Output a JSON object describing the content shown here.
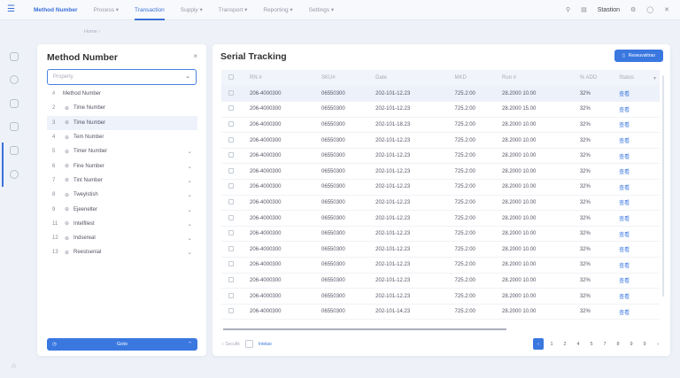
{
  "topbar": {
    "tabs": [
      {
        "label": "Method Number"
      },
      {
        "label": "Process ▾"
      },
      {
        "label": "Transaction"
      },
      {
        "label": "Supply ▾"
      },
      {
        "label": "Transport ▾"
      },
      {
        "label": "Reporting ▾"
      },
      {
        "label": "Settings ▾"
      }
    ],
    "user": "Stastion"
  },
  "breadcrumb": "Home ›",
  "left": {
    "title": "Method Number",
    "select_placeholder": "Property",
    "items": [
      {
        "n": "#",
        "label": "Method Number"
      },
      {
        "n": "2",
        "label": "Time Number"
      },
      {
        "n": "3",
        "label": "Time Number"
      },
      {
        "n": "4",
        "label": "Tem Number"
      },
      {
        "n": "5",
        "label": "Timer Number"
      },
      {
        "n": "6",
        "label": "Fine Number"
      },
      {
        "n": "7",
        "label": "Tint Number"
      },
      {
        "n": "8",
        "label": "Tweylstish"
      },
      {
        "n": "9",
        "label": "Ejeenelter"
      },
      {
        "n": "11",
        "label": "Intelfilest"
      },
      {
        "n": "12",
        "label": "Indsereal"
      },
      {
        "n": "13",
        "label": "Reestsenial"
      }
    ],
    "go_label": "Goto"
  },
  "main": {
    "title": "Serial Tracking",
    "export_label": "Reseuvsiitrao",
    "columns": [
      "RN #",
      "SKU#",
      "Date",
      "MKD",
      "Run #",
      "% ADD",
      "Status"
    ],
    "rows": [
      [
        "206-4000300",
        "06550300",
        "202-101-12.23",
        "725.2:00",
        "28.2000 10.00",
        "32%",
        "查看"
      ],
      [
        "206-4000300",
        "06550300",
        "202-101-12.23",
        "725.2:00",
        "28.2000 15.00",
        "32%",
        "查看"
      ],
      [
        "206-4000300",
        "06550300",
        "202-101-18.23",
        "725.2:00",
        "28.2000 10.00",
        "32%",
        "查看"
      ],
      [
        "206-4000300",
        "06550300",
        "202-101-12.23",
        "725.2:00",
        "28.2000 10.00",
        "32%",
        "查看"
      ],
      [
        "206-4000300",
        "06550300",
        "202-101-12.23",
        "725.2:00",
        "28.2000 10.00",
        "32%",
        "查看"
      ],
      [
        "206-4000300",
        "06550300",
        "202-101-12.23",
        "725.2:00",
        "28.2000 10.00",
        "32%",
        "查看"
      ],
      [
        "206-4000300",
        "06550300",
        "202-101-12.23",
        "725.2:00",
        "28.2000 10.00",
        "32%",
        "查看"
      ],
      [
        "206-4000300",
        "06550300",
        "202-101-12.23",
        "725.2:00",
        "28.2000 10.00",
        "32%",
        "查看"
      ],
      [
        "206-4000300",
        "06550300",
        "202-101-12.23",
        "725.2:00",
        "28.2000 10.00",
        "32%",
        "查看"
      ],
      [
        "206-4000300",
        "06550300",
        "202-101-12.23",
        "725.2:00",
        "28.2000 10.00",
        "32%",
        "查看"
      ],
      [
        "206-4000300",
        "06550300",
        "202-101-12.23",
        "725.2:00",
        "28.2000 10.00",
        "32%",
        "查看"
      ],
      [
        "206-4000300",
        "06550300",
        "202-101-12.23",
        "725.2:00",
        "28.2000 10.00",
        "32%",
        "查看"
      ],
      [
        "206-4000300",
        "06550300",
        "202-101-12.23",
        "725.2:00",
        "28.2000 10.00",
        "32%",
        "查看"
      ],
      [
        "206-4000300",
        "06550300",
        "202-101-12.23",
        "725.2:00",
        "28.2000 10.00",
        "32%",
        "查看"
      ],
      [
        "206-4000300",
        "06550300",
        "202-101-14.23",
        "725.2:00",
        "28.2000 10.00",
        "32%",
        "查看"
      ]
    ],
    "footer": {
      "select_label": "Secultk",
      "link_label": "Intelao"
    },
    "pages": [
      "1",
      "2",
      "4",
      "5",
      "7",
      "8",
      "9",
      "9"
    ],
    "prev": "‹",
    "next": "›"
  }
}
